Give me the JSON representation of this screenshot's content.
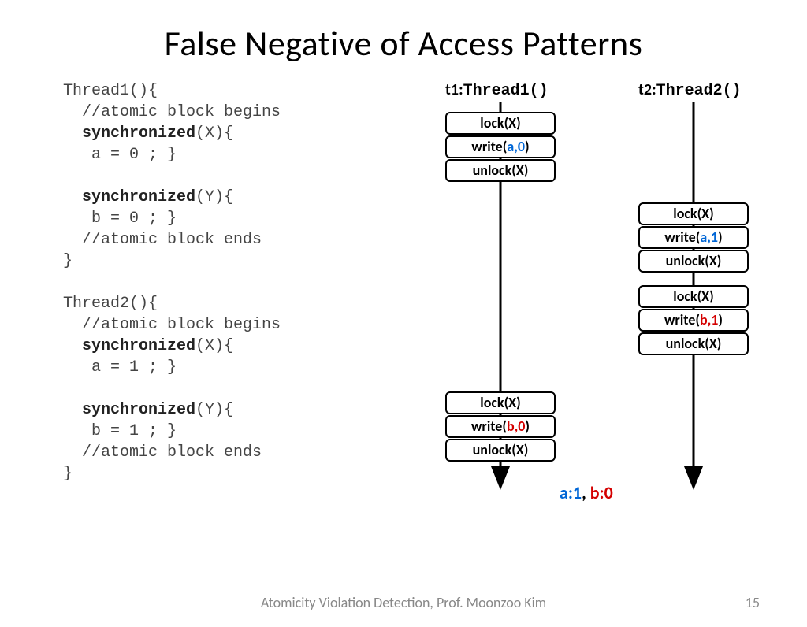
{
  "title": "False Negative of Access Patterns",
  "code": {
    "t1_header": "Thread1(){",
    "c1": "  //atomic block begins",
    "sync_x": "synchronized",
    "sync_x_arg": "(X){",
    "a0": "   a = 0 ; }",
    "sync_y": "synchronized",
    "sync_y_arg": "(Y){",
    "b0": "   b = 0 ; }",
    "c2": "  //atomic block ends",
    "close": "}",
    "t2_header": "Thread2(){",
    "a1": "   a = 1 ; }",
    "b1": "   b = 1 ; }"
  },
  "headers": {
    "t1_label": "t1:",
    "t1_fn": "Thread1()",
    "t2_label": "t2:",
    "t2_fn": "Thread2()"
  },
  "ops": {
    "lockX": "lock(X)",
    "unlockX": "unlock(X)",
    "write_pref": "write(",
    "a0": "a,0",
    "a1": "a,1",
    "b0": "b,0",
    "b1": "b,1",
    "close": ")"
  },
  "result": {
    "a_label": "a:1",
    "sep": ", ",
    "b_label": "b:0"
  },
  "footer": "Atomicity Violation Detection, Prof. Moonzoo Kim",
  "page": "15"
}
